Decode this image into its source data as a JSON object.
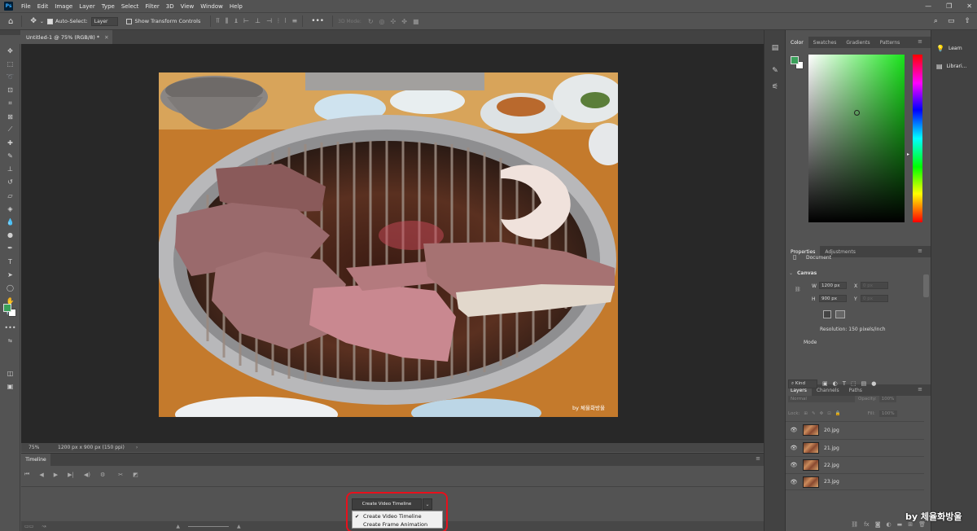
{
  "app": {
    "logo": "Ps"
  },
  "menu": [
    "File",
    "Edit",
    "Image",
    "Layer",
    "Type",
    "Select",
    "Filter",
    "3D",
    "View",
    "Window",
    "Help"
  ],
  "options_bar": {
    "auto_select_label": "Auto-Select:",
    "auto_select_target": "Layer",
    "show_transform_label": "Show Transform Controls",
    "mode_3d_label": "3D Mode:"
  },
  "document": {
    "tab_title": "Untitled-1 @ 75% (RGB/8) *",
    "zoom": "75%",
    "status": "1200 px x 900 px (150 ppi)",
    "photo_watermark": "by 체율화방울"
  },
  "timeline": {
    "tab_label": "Timeline",
    "create_button": "Create Video Timeline",
    "menu_items": [
      {
        "label": "Create Video Timeline",
        "checked": "✔"
      },
      {
        "label": "Create Frame Animation",
        "checked": ""
      }
    ]
  },
  "color_panel": {
    "tabs": [
      "Color",
      "Swatches",
      "Gradients",
      "Patterns"
    ],
    "foreground": "#3aa05a",
    "background": "#ffffff",
    "hue": "#1ae31c"
  },
  "properties_panel": {
    "tabs": [
      "Properties",
      "Adjustments"
    ],
    "document_label": "Document",
    "canvas_label": "Canvas",
    "width_label": "W",
    "width_value": "1200 px",
    "height_label": "H",
    "height_value": "900 px",
    "x_label": "X",
    "x_placeholder": "0 px",
    "y_label": "Y",
    "y_placeholder": "0 px",
    "resolution": "Resolution: 150 pixels/inch",
    "mode_label": "Mode"
  },
  "layers_panel": {
    "tabs": [
      "Layers",
      "Channels",
      "Paths"
    ],
    "kind_label": "Kind",
    "blend_mode": "Normal",
    "opacity_label": "Opacity:",
    "opacity_value": "100%",
    "lock_label": "Lock:",
    "fill_label": "Fill:",
    "fill_value": "100%",
    "layers": [
      {
        "name": "20.jpg"
      },
      {
        "name": "21.jpg"
      },
      {
        "name": "22.jpg"
      },
      {
        "name": "23.jpg"
      }
    ]
  },
  "far_right": {
    "items": [
      "Learn",
      "Librari..."
    ]
  },
  "watermark": "by 체율화방울"
}
